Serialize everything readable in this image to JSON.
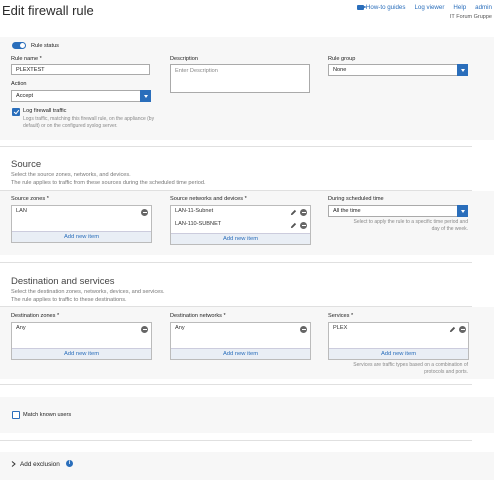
{
  "header": {
    "title": "Edit firewall rule",
    "links": [
      "How-to guides",
      "Log viewer",
      "Help",
      "admin"
    ],
    "org": "IT Forum Gruppe"
  },
  "rule_status": {
    "label": "Rule status",
    "enabled": true
  },
  "rule_name": {
    "label": "Rule name",
    "value": "PLEXTEST"
  },
  "description": {
    "label": "Description",
    "placeholder": "Enter Description"
  },
  "rule_group": {
    "label": "Rule group",
    "value": "None"
  },
  "action": {
    "label": "Action",
    "value": "Accept"
  },
  "log_traffic": {
    "label": "Log firewall traffic",
    "checked": true,
    "hint_line1": "Logs traffic, matching this firewall rule, on the appliance (by",
    "hint_line2": "default) or on the configured syslog server."
  },
  "source": {
    "title": "Source",
    "desc1": "Select the source zones, networks, and devices.",
    "desc2": "The rule applies to traffic from these sources during the scheduled time period.",
    "zones_label": "Source zones",
    "zones": [
      "LAN"
    ],
    "networks_label": "Source networks and devices",
    "networks": [
      "LAN-11-Subnet",
      "LAN-110-SUBNET"
    ],
    "schedule_label": "During scheduled time",
    "schedule_value": "All the time",
    "schedule_hint1": "Select to apply the rule to a specific time period and",
    "schedule_hint2": "day of the week.",
    "add_new": "Add new item"
  },
  "destination": {
    "title": "Destination and services",
    "desc1": "Select the destination zones, networks, devices, and services.",
    "desc2": "The rule applies to traffic to these destinations.",
    "zones_label": "Destination zones",
    "zones": [
      "Any"
    ],
    "networks_label": "Destination networks",
    "networks": [
      "Any"
    ],
    "services_label": "Services",
    "services": [
      "PLEX"
    ],
    "services_hint1": "Services are traffic types based on a combination of",
    "services_hint2": "protocols and ports.",
    "add_new": "Add new item"
  },
  "match_users": {
    "label": "Match known users",
    "checked": false
  },
  "exclusion": {
    "label": "Add exclusion"
  },
  "colors": {
    "accent": "#2a6ebb",
    "panel": "#f7f7f7"
  }
}
